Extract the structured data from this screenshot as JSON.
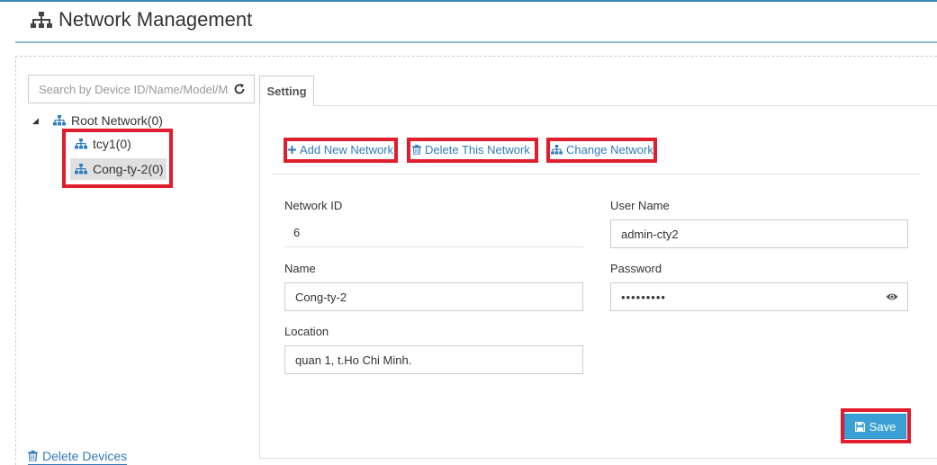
{
  "header": {
    "title": "Network Management"
  },
  "search": {
    "placeholder": "Search by Device ID/Name/Model/MAC"
  },
  "tree": {
    "root": {
      "label": "Root Network(0)"
    },
    "children": [
      {
        "label": "tcy1(0)"
      },
      {
        "label": "Cong-ty-2(0)"
      }
    ]
  },
  "sidebar": {
    "delete_devices_label": "Delete Devices"
  },
  "tabs": [
    {
      "label": "Setting"
    }
  ],
  "actions": {
    "add_label": "Add New Network",
    "delete_label": "Delete This Network",
    "change_label": "Change Network"
  },
  "form": {
    "network_id": {
      "label": "Network ID",
      "value": "6"
    },
    "name": {
      "label": "Name",
      "value": "Cong-ty-2"
    },
    "location": {
      "label": "Location",
      "value": "quan 1, t.Ho Chi Minh."
    },
    "user_name": {
      "label": "User Name",
      "value": "admin-cty2"
    },
    "password": {
      "label": "Password",
      "value": "•••••••••"
    }
  },
  "save_label": "Save",
  "colors": {
    "accent": "#337ab7",
    "highlight": "#e01d2c",
    "save_bg": "#3ba0d6"
  },
  "icons": {
    "header": "sitemap-icon",
    "refresh": "refresh-icon",
    "tree_node": "sitemap-icon",
    "add": "plus-icon",
    "delete": "trash-icon",
    "change": "sitemap-icon",
    "password_toggle": "eye-icon",
    "save": "floppy-disk-icon"
  }
}
